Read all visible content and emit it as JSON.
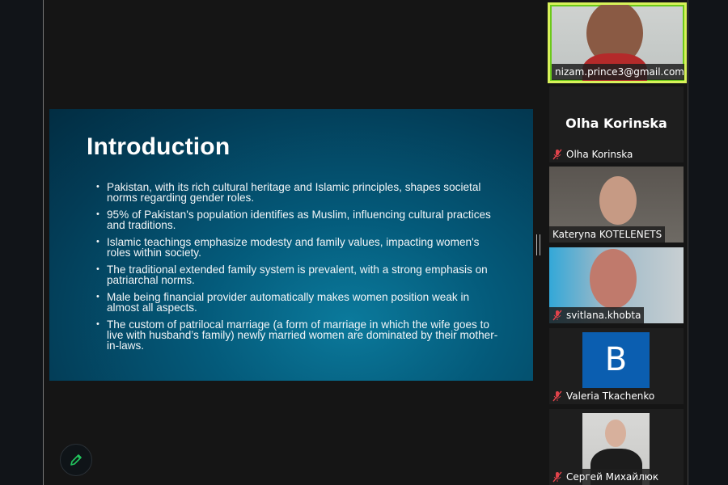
{
  "slide": {
    "title": "Introduction",
    "bullets": [
      "Pakistan, with its rich cultural heritage and Islamic principles, shapes societal norms regarding gender roles.",
      "95% of Pakistan's population identifies as Muslim, influencing cultural practices and traditions.",
      "Islamic teachings emphasize modesty and family values, impacting women's roles within society.",
      "The traditional extended family system is prevalent, with a strong emphasis on patriarchal norms.",
      "Male being financial provider automatically makes women position weak in almost all aspects.",
      "The custom of patrilocal marriage (a form of marriage in which the wife goes to live with husband’s family) newly married women are dominated by their mother-in-laws."
    ]
  },
  "participants": [
    {
      "name": "nizam.prince3@gmail.com",
      "muted": false,
      "speaking": true
    },
    {
      "name": "Olha Korinska",
      "display": "Olha Korinska",
      "muted": true
    },
    {
      "name": "Kateryna KOTELENETS",
      "muted": false
    },
    {
      "name": "svitlana.khobta",
      "muted": true
    },
    {
      "name": "Valeria Tkachenko",
      "avatar_letter": "B",
      "muted": true
    },
    {
      "name": "Сергей Михайлюк",
      "muted": true
    }
  ],
  "colors": {
    "speaking_border": "#d8f25a",
    "muted_icon": "#e0434b",
    "avatar_bg": "#0b5eb0",
    "annotate_icon": "#22c55e"
  }
}
